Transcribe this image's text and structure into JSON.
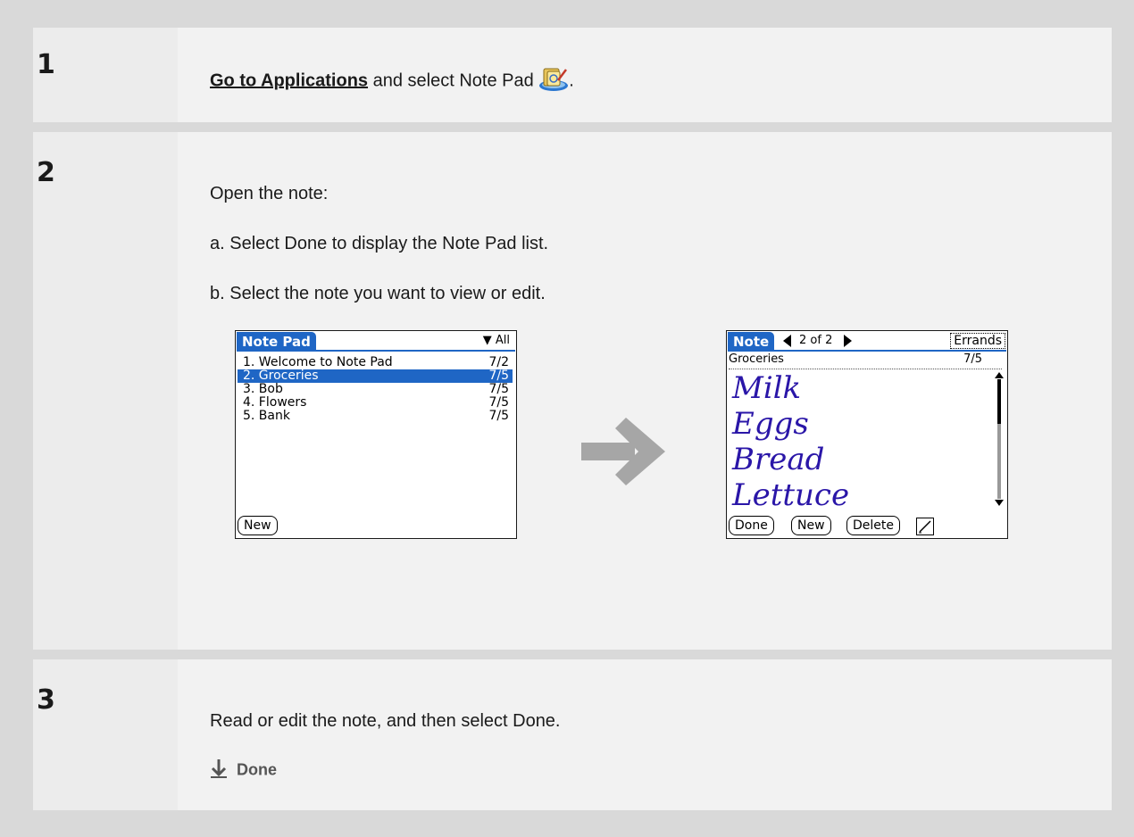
{
  "steps": [
    {
      "number": "1",
      "link_text": "Go to Applications",
      "text_after": " and select Note Pad",
      "period": ".",
      "icon": "note-pad-app-icon"
    },
    {
      "number": "2",
      "intro": "Open the note:",
      "sub_a": "a.  Select Done to display the Note Pad list.",
      "sub_b": "b.  Select the note you want to view or edit."
    },
    {
      "number": "3",
      "text": "Read or edit the note, and then select Done.",
      "done_label": "Done",
      "done_icon": "arrow-down-icon"
    }
  ],
  "list_screen": {
    "title": "Note Pad",
    "category": "▼ All",
    "rows": [
      {
        "label": "1. Welcome to Note Pad",
        "date": "7/2",
        "selected": false
      },
      {
        "label": "2. Groceries",
        "date": "7/5",
        "selected": true
      },
      {
        "label": "3. Bob",
        "date": "7/5",
        "selected": false
      },
      {
        "label": "4. Flowers",
        "date": "7/5",
        "selected": false
      },
      {
        "label": "5. Bank",
        "date": "7/5",
        "selected": false
      }
    ],
    "new_button": "New"
  },
  "note_screen": {
    "title": "Note",
    "prev_icon": "triangle-left-icon",
    "position": "2 of 2",
    "next_icon": "triangle-right-icon",
    "category": "Errands",
    "note_name": "Groceries",
    "note_date": "7/5",
    "handwriting": [
      "Milk",
      "Eggs",
      "Bread",
      "Lettuce"
    ],
    "buttons": {
      "done": "Done",
      "new": "New",
      "delete": "Delete"
    },
    "pen_icon": "pen-icon"
  },
  "colors": {
    "palm_blue": "#1f66c5",
    "handwriting": "#2a16a8"
  }
}
